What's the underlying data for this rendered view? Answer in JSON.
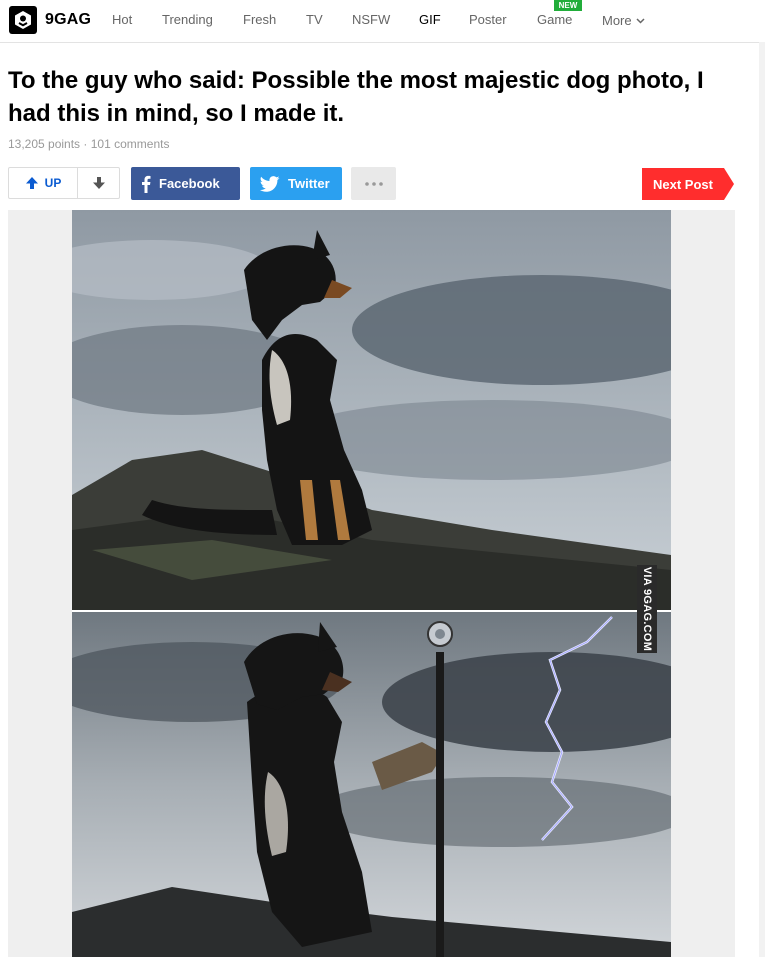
{
  "nav": {
    "brand": "9GAG",
    "items": [
      {
        "label": "Hot"
      },
      {
        "label": "Trending"
      },
      {
        "label": "Fresh"
      },
      {
        "label": "TV"
      },
      {
        "label": "NSFW"
      },
      {
        "label": "GIF"
      },
      {
        "label": "Poster"
      },
      {
        "label": "Game"
      },
      {
        "label": "More"
      }
    ],
    "active": "GIF",
    "new_badge": "NEW"
  },
  "post": {
    "title": "To the guy who said: Possible the most majestic dog photo, I had this in mind, so I made it.",
    "points": "13,205 points",
    "separator": "·",
    "comments": "101 comments",
    "watermark": "VIA 9GAG.COM"
  },
  "actions": {
    "up_label": "UP",
    "facebook_label": "Facebook",
    "twitter_label": "Twitter",
    "next_label": "Next Post"
  },
  "colors": {
    "facebook": "#3b5998",
    "twitter": "#2ba0f0",
    "next": "#ff2d2d",
    "upvote": "#0b5bd1",
    "new_badge": "#21ad3a"
  },
  "icons": [
    "9gag-logo-icon",
    "chevron-down-icon",
    "upvote-arrow-icon",
    "downvote-arrow-icon",
    "facebook-icon",
    "twitter-icon",
    "more-dots-icon"
  ]
}
